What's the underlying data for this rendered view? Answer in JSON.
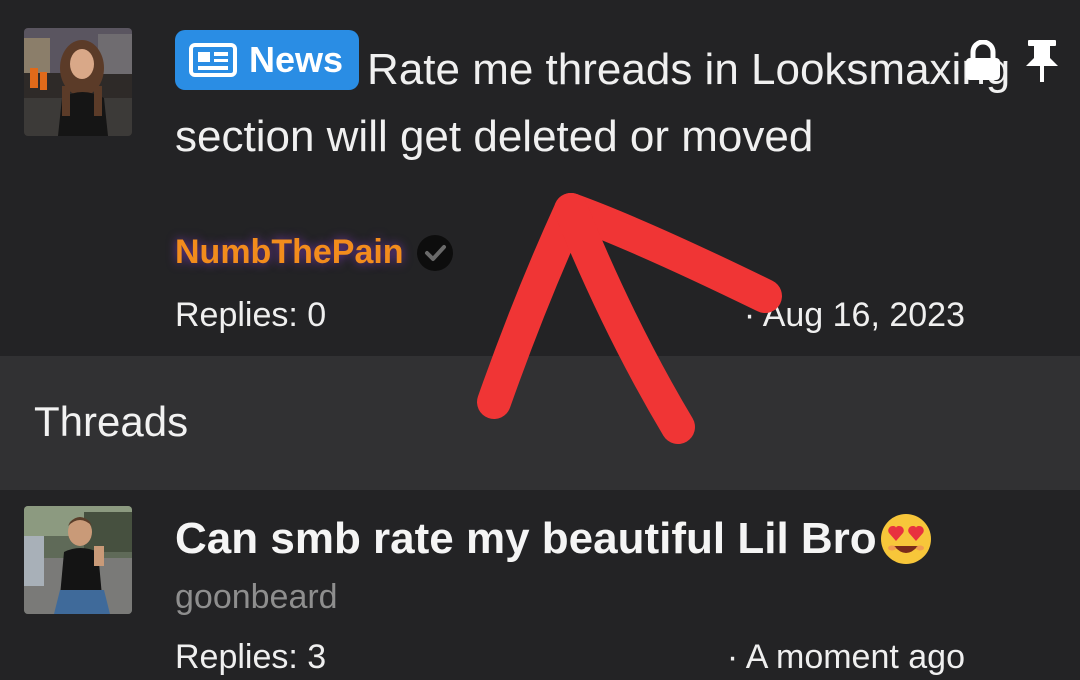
{
  "featured_thread": {
    "badge_label": "News",
    "title": "Rate me threads in Looksmaxing section will get deleted or moved",
    "author": "NumbThePain",
    "replies": "Replies: 0",
    "date": "· Aug 16, 2023",
    "status_icons": [
      "lock-icon",
      "pin-icon"
    ]
  },
  "section": {
    "title": "Threads"
  },
  "threads": [
    {
      "title": "Can smb rate my beautiful Lil Bro",
      "emoji": "smiling-face-with-heart-eyes",
      "author": "goonbeard",
      "replies": "Replies: 3",
      "time": "· A moment ago"
    }
  ],
  "colors": {
    "background": "#232325",
    "section_header": "#313133",
    "badge": "#2a8de4",
    "author_highlight": "#f28c1c",
    "annotation": "#f03535"
  }
}
